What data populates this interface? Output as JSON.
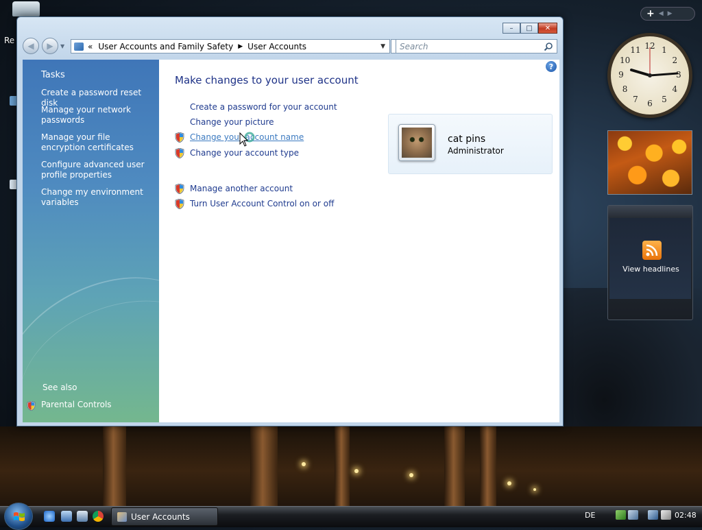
{
  "window": {
    "breadcrumb": [
      "User Accounts and Family Safety",
      "User Accounts"
    ],
    "breadcrumb_prefix": "«",
    "search_placeholder": "Search",
    "caption": {
      "minimize": "–",
      "maximize": "□",
      "close": "✕"
    }
  },
  "sidebar": {
    "title": "Tasks",
    "links": [
      "Create a password reset disk",
      "Manage your network passwords",
      "Manage your file encryption certificates",
      "Configure advanced user profile properties",
      "Change my environment variables"
    ],
    "see_also": "See also",
    "parental_controls": "Parental Controls"
  },
  "main": {
    "title": "Make changes to your user account",
    "tasks": [
      "Create a password for your account",
      "Change your picture",
      "Change your account name",
      "Change your account type",
      "Manage another account",
      "Turn User Account Control on or off"
    ],
    "help": "?"
  },
  "account": {
    "name": "cat pins",
    "role": "Administrator"
  },
  "desktop": {
    "label": "Re"
  },
  "gadgets": {
    "clock_numbers": [
      "12",
      "1",
      "2",
      "3",
      "4",
      "5",
      "6",
      "7",
      "8",
      "9",
      "10",
      "11"
    ],
    "feed_label": "View headlines"
  },
  "taskbar": {
    "task_label": "User Accounts",
    "language": "DE",
    "time": "02:48"
  }
}
